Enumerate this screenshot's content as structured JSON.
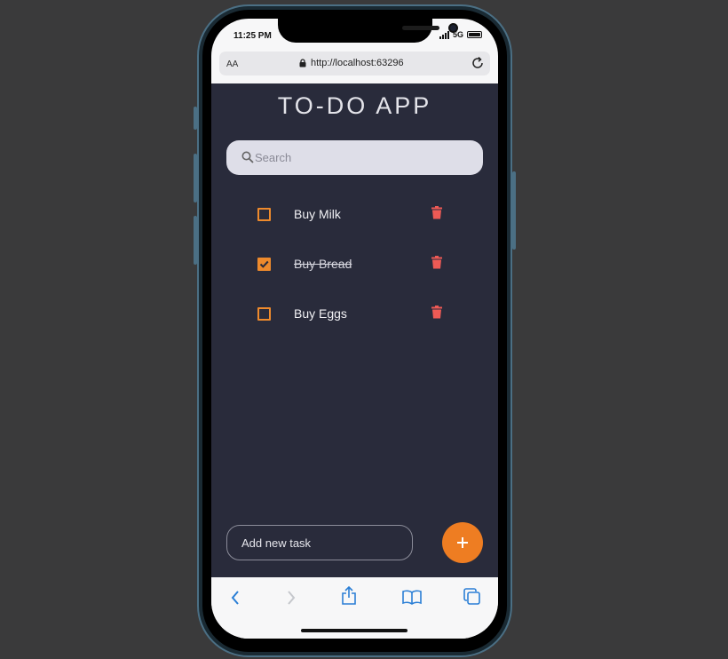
{
  "status_bar": {
    "time": "11:25 PM",
    "network": "5G"
  },
  "browser": {
    "text_size_label": "AA",
    "url": "http://localhost:63296"
  },
  "app": {
    "title": "TO-DO APP",
    "search": {
      "placeholder": "Search"
    },
    "todos": [
      {
        "label": "Buy Milk",
        "done": false
      },
      {
        "label": "Buy Bread",
        "done": true
      },
      {
        "label": "Buy Eggs",
        "done": false
      }
    ],
    "add_task": {
      "placeholder": "Add new task"
    }
  },
  "colors": {
    "accent": "#ee7d22",
    "delete": "#ee5a55",
    "background": "#292b3b",
    "link_blue": "#2b7fd6"
  },
  "icons": [
    "search-icon",
    "trash-icon",
    "plus-icon",
    "lock-icon",
    "reload-icon",
    "back-icon",
    "forward-icon",
    "share-icon",
    "bookmarks-icon",
    "tabs-icon"
  ]
}
